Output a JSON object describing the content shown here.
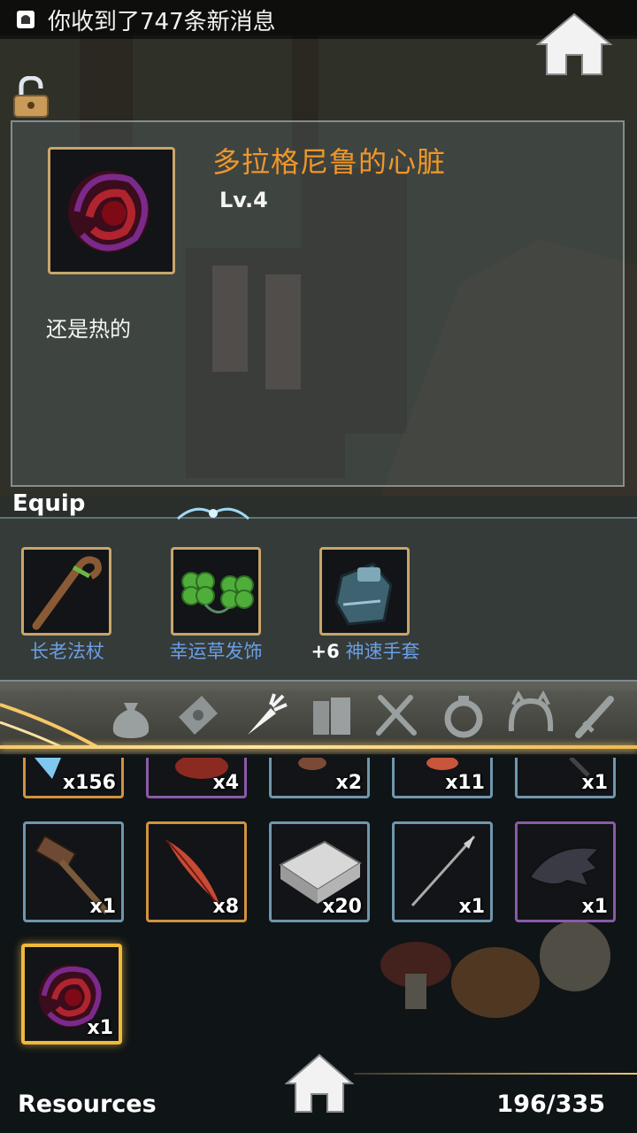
{
  "status_bar": {
    "notification_text": "你收到了747条新消息"
  },
  "detail": {
    "name": "多拉格尼鲁的心脏",
    "level": "Lv.4",
    "description": "还是热的",
    "name_color": "#f0962a"
  },
  "equip": {
    "title": "Equip",
    "items": [
      {
        "label": "长老法杖",
        "prefix": "",
        "icon": "staff-icon"
      },
      {
        "label": "幸运草发饰",
        "prefix": "",
        "icon": "clover-icon"
      },
      {
        "label": "神速手套",
        "prefix": "+6",
        "icon": "gauntlet-icon"
      }
    ]
  },
  "categories": [
    "bag-icon",
    "scroll-icon",
    "carrot-icon",
    "books-icon",
    "utensils-icon",
    "ring-icon",
    "headband-icon",
    "sword-icon"
  ],
  "inventory": {
    "row1": [
      {
        "qty": "x156",
        "icon": "crystal-icon"
      },
      {
        "qty": "x4",
        "icon": "red-gem-icon"
      },
      {
        "qty": "x2",
        "icon": "material-icon"
      },
      {
        "qty": "x11",
        "icon": "feather-icon"
      },
      {
        "qty": "x1",
        "icon": "dark-item-icon"
      }
    ],
    "row2": [
      {
        "qty": "x1",
        "icon": "hammer-icon"
      },
      {
        "qty": "x8",
        "icon": "red-feather-icon"
      },
      {
        "qty": "x20",
        "icon": "stone-slab-icon"
      },
      {
        "qty": "x1",
        "icon": "spear-icon"
      },
      {
        "qty": "x1",
        "icon": "bat-wing-icon"
      }
    ],
    "row3": [
      {
        "qty": "x1",
        "icon": "dragon-heart-icon"
      }
    ]
  },
  "footer": {
    "label": "Resources",
    "count": "196/335"
  }
}
